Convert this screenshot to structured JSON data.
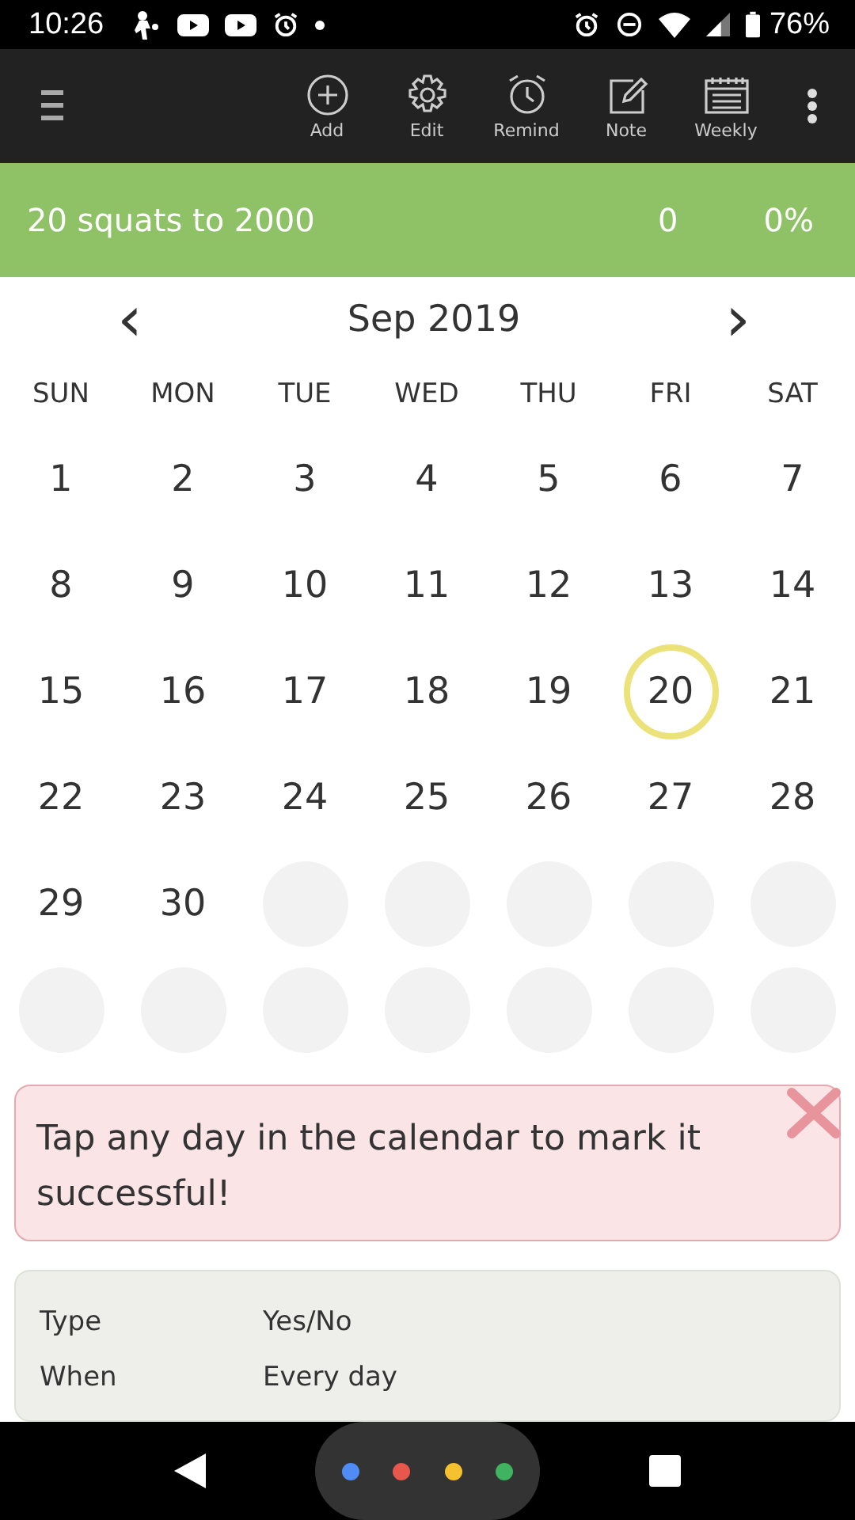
{
  "status_bar": {
    "time": "10:26",
    "battery": "76%"
  },
  "toolbar": {
    "actions": [
      {
        "label": "Add",
        "kind": "add"
      },
      {
        "label": "Edit",
        "kind": "edit"
      },
      {
        "label": "Remind",
        "kind": "remind"
      },
      {
        "label": "Note",
        "kind": "note"
      },
      {
        "label": "Weekly",
        "kind": "weekly"
      }
    ]
  },
  "goal": {
    "title": "20 squats to 2000",
    "count": "0",
    "percent": "0%"
  },
  "calendar": {
    "month": "Sep 2019",
    "prev": "‹",
    "next": "›",
    "weekdays": [
      "SUN",
      "MON",
      "TUE",
      "WED",
      "THU",
      "FRI",
      "SAT"
    ],
    "weeks": [
      [
        {
          "label": "1",
          "today": false
        },
        {
          "label": "2",
          "today": false
        },
        {
          "label": "3",
          "today": false
        },
        {
          "label": "4",
          "today": false
        },
        {
          "label": "5",
          "today": false
        },
        {
          "label": "6",
          "today": false
        },
        {
          "label": "7",
          "today": false
        }
      ],
      [
        {
          "label": "8",
          "today": false
        },
        {
          "label": "9",
          "today": false
        },
        {
          "label": "10",
          "today": false
        },
        {
          "label": "11",
          "today": false
        },
        {
          "label": "12",
          "today": false
        },
        {
          "label": "13",
          "today": false
        },
        {
          "label": "14",
          "today": false
        }
      ],
      [
        {
          "label": "15",
          "today": false
        },
        {
          "label": "16",
          "today": false
        },
        {
          "label": "17",
          "today": false
        },
        {
          "label": "18",
          "today": false
        },
        {
          "label": "19",
          "today": false
        },
        {
          "label": "20",
          "today": true
        },
        {
          "label": "21",
          "today": false
        }
      ],
      [
        {
          "label": "22",
          "today": false
        },
        {
          "label": "23",
          "today": false
        },
        {
          "label": "24",
          "today": false
        },
        {
          "label": "25",
          "today": false
        },
        {
          "label": "26",
          "today": false
        },
        {
          "label": "27",
          "today": false
        },
        {
          "label": "28",
          "today": false
        }
      ],
      [
        {
          "label": "29",
          "today": false
        },
        {
          "label": "30",
          "today": false
        },
        {
          "kind": "empty"
        },
        {
          "kind": "empty"
        },
        {
          "kind": "empty"
        },
        {
          "kind": "empty"
        },
        {
          "kind": "empty"
        }
      ],
      [
        {
          "kind": "empty"
        },
        {
          "kind": "empty"
        },
        {
          "kind": "empty"
        },
        {
          "kind": "empty"
        },
        {
          "kind": "empty"
        },
        {
          "kind": "empty"
        },
        {
          "kind": "empty"
        }
      ]
    ]
  },
  "hint": {
    "text": "Tap any day in the calendar to mark it successful!"
  },
  "details": [
    {
      "label": "Type",
      "value": "Yes/No"
    },
    {
      "label": "When",
      "value": "Every day"
    }
  ],
  "assistant_dots": [
    {
      "color": "#4f8cf5"
    },
    {
      "color": "#e8574c"
    },
    {
      "color": "#f6c12e"
    },
    {
      "color": "#3fb35f"
    }
  ]
}
